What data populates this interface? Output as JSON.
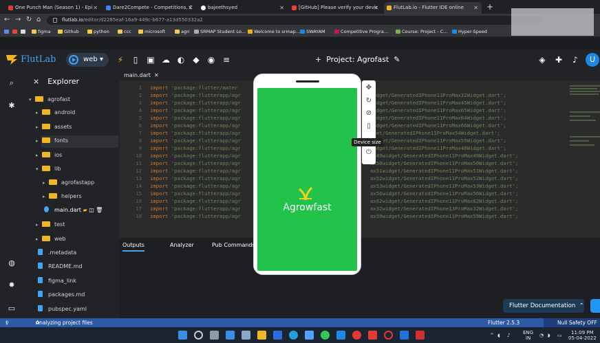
{
  "browser": {
    "tabs": [
      {
        "label": "One Punch Man (Season 1) - Epi",
        "color": "#e53935"
      },
      {
        "label": "Dare2Compete - Competitions, C",
        "color": "#3b82f6"
      },
      {
        "label": "bajeethsyed",
        "color": "#ffffff"
      },
      {
        "label": "[GitHub] Please verify your devic",
        "color": "#ea4335"
      },
      {
        "label": "FlutLab.io - Flutter IDE online",
        "color": "#f1b621"
      }
    ],
    "new_tab": "+",
    "url_host": "flutlab.io",
    "url_path": "/editor/d2285eaf-16a9-449c-b677-a13d550332a2",
    "bookmarks": [
      "figma",
      "Github",
      "python",
      "ccc",
      "microsoft",
      "agri",
      "SRMAP Student Lo...",
      "Welcome to srmap...",
      "SWAYAM",
      "Competitive Progra...",
      "Course: Project - C...",
      "Hyper-Speed"
    ]
  },
  "header": {
    "logo": "FlutLab",
    "target": "web",
    "project": "Project: Agrofast",
    "avatar": "U"
  },
  "explorer": {
    "title": "Explorer",
    "items": [
      {
        "label": "agrofast",
        "type": "folder",
        "open": true
      },
      {
        "label": "android",
        "type": "folder"
      },
      {
        "label": "assets",
        "type": "folder"
      },
      {
        "label": "fonts",
        "type": "folder"
      },
      {
        "label": "ios",
        "type": "folder"
      },
      {
        "label": "lib",
        "type": "folder",
        "open": true
      },
      {
        "label": "agrofastapp",
        "type": "folder"
      },
      {
        "label": "helpers",
        "type": "folder"
      },
      {
        "label": "main.dart",
        "type": "file",
        "selected": true
      },
      {
        "label": "test",
        "type": "folder"
      },
      {
        "label": "web",
        "type": "folder"
      },
      {
        "label": ".metadata",
        "type": "file"
      },
      {
        "label": "README.md",
        "type": "file"
      },
      {
        "label": "figma_link",
        "type": "file"
      },
      {
        "label": "packages.md",
        "type": "file"
      },
      {
        "label": "pubspec.yaml",
        "type": "file"
      }
    ]
  },
  "editor": {
    "tab": "main.dart",
    "lines": [
      {
        "n": "1",
        "kw": "import",
        "head": "'package:flutter/mater",
        "tail": ""
      },
      {
        "n": "2",
        "kw": "import",
        "head": "'package:flutterapp/agr",
        "tail": "widget/GeneratedIPhone13ProMax32Widget.dart';"
      },
      {
        "n": "3",
        "kw": "import",
        "head": "'package:flutterapp/agr",
        "tail": "widget/GeneratedIPhone11ProMax45Widget.dart';"
      },
      {
        "n": "4",
        "kw": "import",
        "head": "'package:flutterapp/agr",
        "tail": "widget/GeneratedIPhone11ProMax65Widget.dart';"
      },
      {
        "n": "5",
        "kw": "import",
        "head": "'package:flutterapp/agr",
        "tail": "widget/GeneratedIPhone11ProMax64Widget.dart';"
      },
      {
        "n": "6",
        "kw": "import",
        "head": "'package:flutterapp/agr",
        "tail": "widget/GeneratedIPhone11ProMax66Widget.dart';"
      },
      {
        "n": "7",
        "kw": "import",
        "head": "'package:flutterapp/agr",
        "tail": "iget/GeneratedIPhone11ProMax54Widget.dart';"
      },
      {
        "n": "8",
        "kw": "import",
        "head": "'package:flutterapp/agr",
        "tail": "widget/GeneratedIPhone11ProMax55Widget.dart';"
      },
      {
        "n": "9",
        "kw": "import",
        "head": "'package:flutterapp/agr",
        "tail": "widget/GeneratedIPhone11ProMax48Widget.dart';"
      },
      {
        "n": "10",
        "kw": "import",
        "head": "'package:flutterapp/agr",
        "tail": "ax49widget/GeneratedIPhone11ProMax49Widget.dart';"
      },
      {
        "n": "11",
        "kw": "import",
        "head": "'package:flutterapp/agr",
        "tail": "ax50widget/GeneratedIPhone11ProMax50Widget.dart';"
      },
      {
        "n": "12",
        "kw": "import",
        "head": "'package:flutterapp/agr",
        "tail": "ax51widget/GeneratedIPhone11ProMax51Widget.dart';"
      },
      {
        "n": "13",
        "kw": "import",
        "head": "'package:flutterapp/agr",
        "tail": "ax52widget/GeneratedIPhone11ProMax52Widget.dart';"
      },
      {
        "n": "14",
        "kw": "import",
        "head": "'package:flutterapp/agr",
        "tail": "ax53widget/GeneratedIPhone11ProMax53Widget.dart';"
      },
      {
        "n": "15",
        "kw": "import",
        "head": "'package:flutterapp/agr",
        "tail": "ax56widget/GeneratedIPhone11ProMax56Widget.dart';"
      },
      {
        "n": "16",
        "kw": "import",
        "head": "'package:flutterapp/agr",
        "tail": "ax62widget/GeneratedIPhone11ProMax62Widget.dart';"
      },
      {
        "n": "17",
        "kw": "import",
        "head": "'package:flutterapp/agr",
        "tail": "ax32widget/GeneratedIPhone13ProMax32Widget.dart';"
      },
      {
        "n": "18",
        "kw": "import",
        "head": "'package:flutterapp/agr",
        "tail": "ax59widget/GeneratedIPhone11ProMax59Widget.dart';"
      }
    ]
  },
  "panel": {
    "tabs": [
      "Outputs",
      "Analyzer",
      "Pub Commands"
    ],
    "docs_button": "Flutter Documentation"
  },
  "preview": {
    "app_name": "Agrowfast",
    "tooltip": "Device size",
    "screen_color": "#22c24b"
  },
  "status": {
    "branch": "v",
    "analyzing": "Analyzing project files",
    "flutter_version": "Flutter 2.5.3",
    "null_safety": "Null Safety OFF"
  },
  "taskbar": {
    "lang": "ENG",
    "region": "IN",
    "time": "11:09 PM",
    "date": "05-04-2022"
  }
}
